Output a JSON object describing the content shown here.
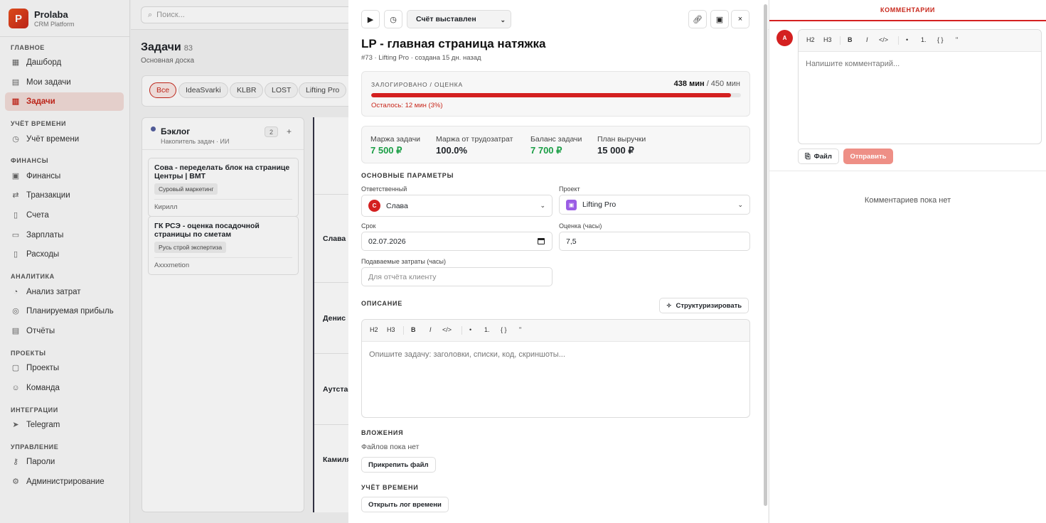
{
  "brand": {
    "logo_letter": "P",
    "name": "Prolaba",
    "subtitle": "CRM Platform"
  },
  "search": {
    "placeholder": "Поиск..."
  },
  "nav": {
    "sections": [
      {
        "title": "ГЛАВНОЕ",
        "items": [
          {
            "label": "Дашборд",
            "icon": "dashboard-icon"
          },
          {
            "label": "Мои задачи",
            "icon": "my-tasks-icon"
          },
          {
            "label": "Задачи",
            "icon": "tasks-icon",
            "active": true
          }
        ]
      },
      {
        "title": "УЧЁТ ВРЕМЕНИ",
        "items": [
          {
            "label": "Учёт времени",
            "icon": "clock-icon"
          }
        ]
      },
      {
        "title": "ФИНАНСЫ",
        "items": [
          {
            "label": "Финансы",
            "icon": "finance-icon"
          },
          {
            "label": "Транзакции",
            "icon": "transactions-icon"
          },
          {
            "label": "Счета",
            "icon": "invoice-icon"
          },
          {
            "label": "Зарплаты",
            "icon": "salary-icon"
          },
          {
            "label": "Расходы",
            "icon": "expenses-icon"
          }
        ]
      },
      {
        "title": "АНАЛИТИКА",
        "items": [
          {
            "label": "Анализ затрат",
            "icon": "cost-analysis-icon"
          },
          {
            "label": "Планируемая прибыль",
            "icon": "profit-icon"
          },
          {
            "label": "Отчёты",
            "icon": "reports-icon"
          }
        ]
      },
      {
        "title": "ПРОЕКТЫ",
        "items": [
          {
            "label": "Проекты",
            "icon": "projects-icon"
          },
          {
            "label": "Команда",
            "icon": "team-icon"
          }
        ]
      },
      {
        "title": "ИНТЕГРАЦИИ",
        "items": [
          {
            "label": "Telegram",
            "icon": "telegram-icon"
          }
        ]
      },
      {
        "title": "УПРАВЛЕНИЕ",
        "items": [
          {
            "label": "Пароли",
            "icon": "key-icon"
          },
          {
            "label": "Администрирование",
            "icon": "gear-icon"
          }
        ]
      }
    ]
  },
  "board": {
    "title": "Задачи",
    "count": "83",
    "subtitle": "Основная доска",
    "filters": [
      "Все",
      "IdeaSvarki",
      "KLBR",
      "LOST",
      "Lifting Pro"
    ],
    "column": {
      "title": "Бэклог",
      "subtitle": "Накопитель задач · ИИ",
      "count": "2",
      "add": "+",
      "cards": [
        {
          "title": "Сова - переделать блок на странице Центры | ВМТ",
          "tag": "Суровый маркетинг",
          "owner": "Кирилл"
        },
        {
          "title": "ГК РСЭ - оценка посадочной страницы по сметам",
          "tag": "Русь строй экспертиза",
          "owner": "Axxxmetion"
        }
      ]
    },
    "lanes": [
      "Слава",
      "Денис",
      "Аутстаф",
      "Камиля"
    ]
  },
  "modal": {
    "status": "Счёт выставлен",
    "title": "LP - главная страница натяжка",
    "meta": "#73 · Lifting Pro · создана 15 дн. назад",
    "time": {
      "label": "ЗАЛОГИРОВАНО / ОЦЕНКА",
      "logged": "438 мин",
      "estimate_text": "/ 450 мин",
      "progress_fraction": 0.973,
      "remaining": "Осталось: 12 мин (3%)"
    },
    "metrics": [
      {
        "label": "Маржа задачи",
        "value": "7 500 ₽",
        "green": true
      },
      {
        "label": "Маржа от трудозатрат",
        "value": "100.0%",
        "green": false
      },
      {
        "label": "Баланс задачи",
        "value": "7 700 ₽",
        "green": true
      },
      {
        "label": "План выручки",
        "value": "15 000 ₽",
        "green": false
      }
    ],
    "params": {
      "section": "ОСНОВНЫЕ ПАРАМЕТРЫ",
      "assignee_label": "Ответственный",
      "assignee_initial": "С",
      "assignee": "Слава",
      "project_label": "Проект",
      "project": "Lifting Pro",
      "due_label": "Срок",
      "due": "02.07.2026",
      "estimate_label": "Оценка (часы)",
      "estimate": "7,5",
      "billed_label": "Подаваемые затраты (часы)",
      "billed_placeholder": "Для отчёта клиенту"
    },
    "description": {
      "section": "ОПИСАНИЕ",
      "structure_button": "Структуризировать",
      "toolbar": [
        "H2",
        "H3",
        "B",
        "I",
        "</>",
        "•",
        "1.",
        "{ }",
        "\""
      ],
      "placeholder": "Опишите задачу: заголовки, списки, код, скриншоты..."
    },
    "attachments": {
      "section": "ВЛОЖЕНИЯ",
      "empty": "Файлов пока нет",
      "attach_button": "Прикрепить файл"
    },
    "timelog": {
      "section": "УЧЁТ ВРЕМЕНИ",
      "open_button": "Открыть лог времени"
    }
  },
  "comments": {
    "header": "КОММЕНТАРИИ",
    "avatar": "A",
    "toolbar": [
      "H2",
      "H3",
      "B",
      "I",
      "</>",
      "•",
      "1.",
      "{ }",
      "\""
    ],
    "placeholder": "Напишите комментарий...",
    "file_button": "Файл",
    "send_button": "Отправить",
    "empty": "Комментариев пока нет"
  },
  "colors": {
    "accent": "#c8271b",
    "danger": "#d42020",
    "success": "#1a9e45",
    "send_disabled": "#ee8f86"
  }
}
